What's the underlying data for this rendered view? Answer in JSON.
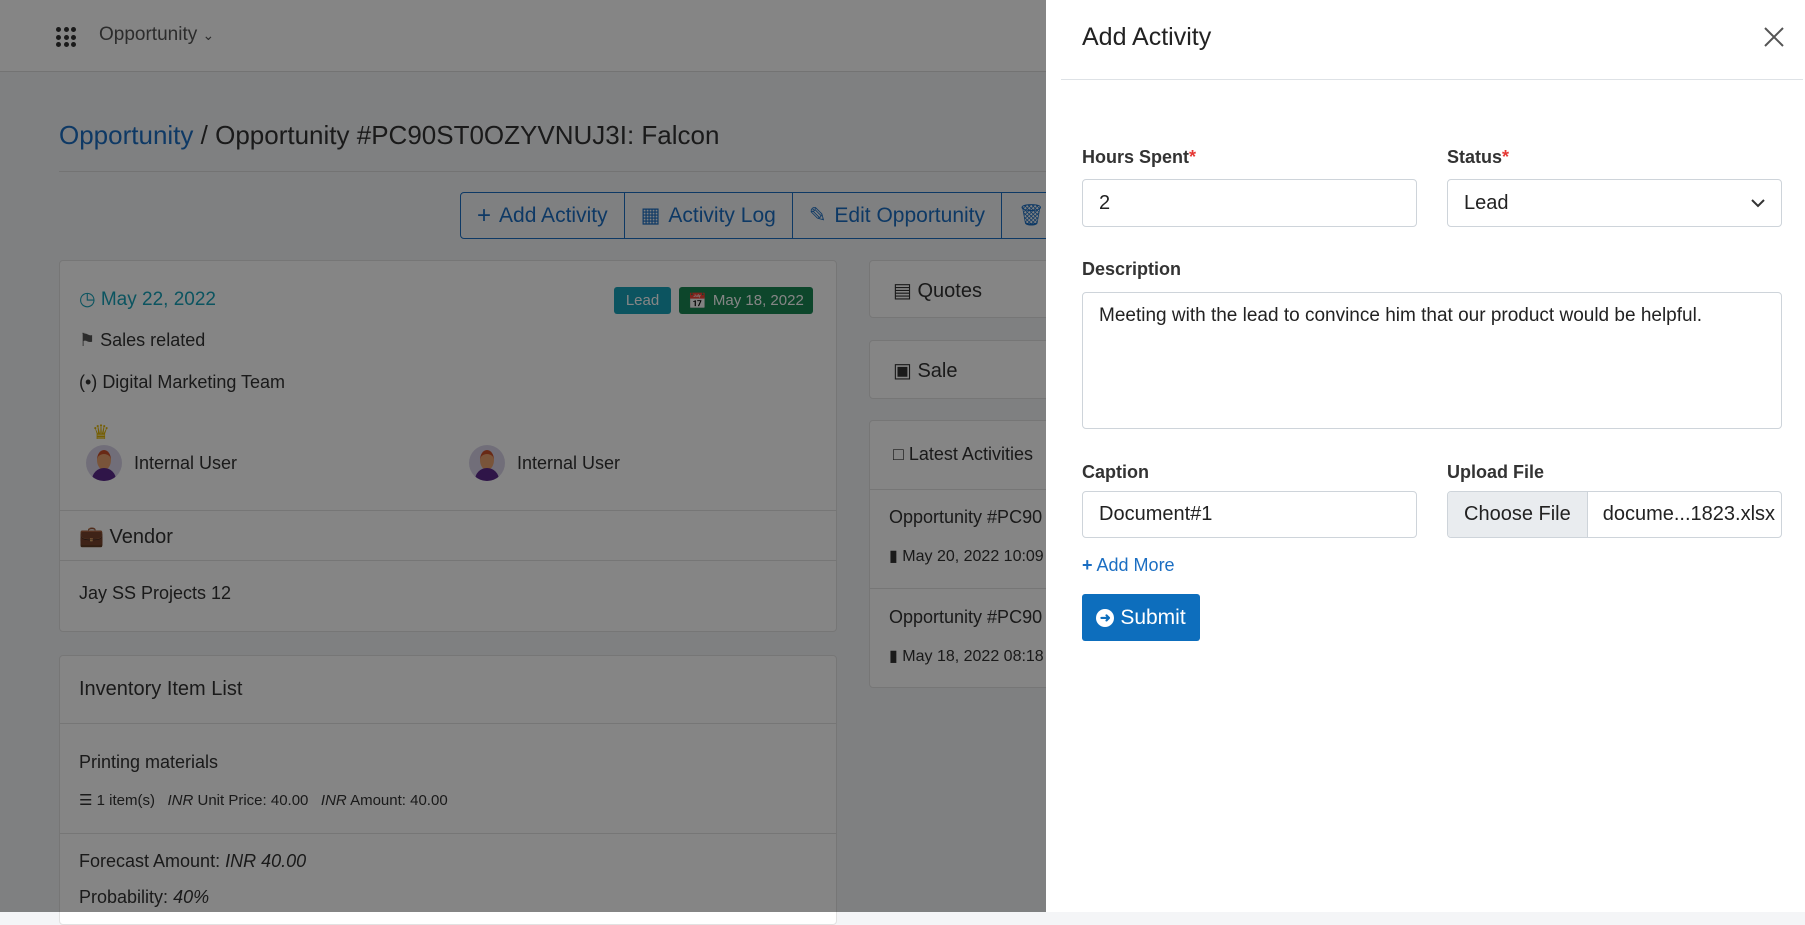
{
  "topbar": {
    "app_menu": "Opportunity"
  },
  "breadcrumb": {
    "root": "Opportunity",
    "separator": "/",
    "current": "Opportunity #PC90ST0OZYVNUJ3I: Falcon"
  },
  "actions": {
    "add_activity": "Add Activity",
    "activity_log": "Activity Log",
    "edit_opportunity": "Edit Opportunity"
  },
  "summary": {
    "date": "May 22, 2022",
    "status_badge": "Lead",
    "created_badge": "May 18, 2022",
    "category": "Sales related",
    "team": "Digital Marketing Team",
    "users": [
      "Internal User",
      "Internal User"
    ],
    "vendor_title": "Vendor",
    "vendor_name": "Jay SS Projects 12"
  },
  "inventory": {
    "title": "Inventory Item List",
    "item_name": "Printing materials",
    "qty": "1 item(s)",
    "currency": "INR",
    "unit_price_label": "Unit Price: 40.00",
    "amount_label": "Amount: 40.00",
    "forecast_label": "Forecast Amount:",
    "forecast_value": "INR 40.00",
    "probability_label": "Probability:",
    "probability_value": "40%"
  },
  "side": {
    "quotes": "Quotes",
    "sale": "Sale",
    "latest_title": "Latest Activities",
    "activities": [
      {
        "title": "Opportunity #PC90",
        "date": "May 20, 2022 10:09"
      },
      {
        "title": "Opportunity #PC90",
        "date": "May 18, 2022 08:18"
      }
    ]
  },
  "panel": {
    "title": "Add Activity",
    "hours_label": "Hours Spent",
    "hours_value": "2",
    "status_label": "Status",
    "status_value": "Lead",
    "required_mark": "*",
    "description_label": "Description",
    "description_value": "Meeting with the lead to convince him that our product would be helpful.",
    "caption_label": "Caption",
    "caption_value": "Document#1",
    "upload_label": "Upload File",
    "choose_file": "Choose File",
    "file_name": "docume...1823.xlsx",
    "add_more": "Add More",
    "submit": "Submit"
  },
  "colors": {
    "primary": "#1b6ec2",
    "info_badge": "#17a2b8",
    "success_badge": "#198754",
    "required": "#e53935"
  }
}
